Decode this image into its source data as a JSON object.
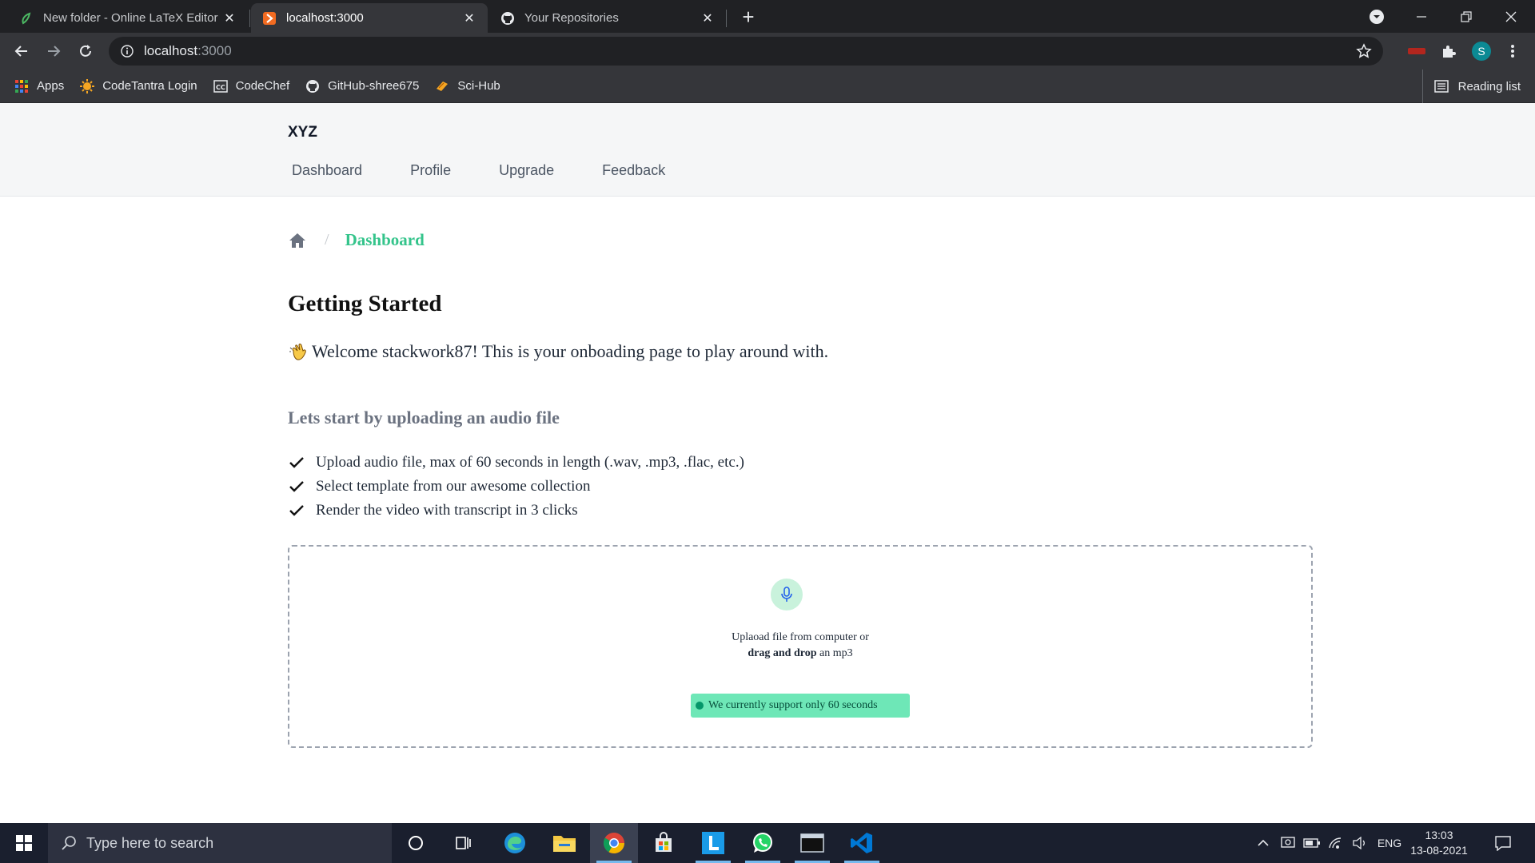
{
  "browser": {
    "tabs": [
      {
        "title": "New folder - Online LaTeX Editor",
        "favicon": "overleaf-leaf-icon",
        "active": false
      },
      {
        "title": "localhost:3000",
        "favicon": "orange-app-icon",
        "active": true
      },
      {
        "title": "Your Repositories",
        "favicon": "github-icon",
        "active": false
      }
    ],
    "url_host": "localhost",
    "url_port": ":3000",
    "profile_initial": "S",
    "bookmarks": [
      {
        "label": "Apps",
        "icon": "apps-grid-icon"
      },
      {
        "label": "CodeTantra Login",
        "icon": "codetantra-icon"
      },
      {
        "label": "CodeChef",
        "icon": "codechef-icon"
      },
      {
        "label": "GitHub-shree675",
        "icon": "github-icon"
      },
      {
        "label": "Sci-Hub",
        "icon": "scihub-icon"
      }
    ],
    "reading_list_label": "Reading list"
  },
  "app": {
    "brand": "XYZ",
    "nav": [
      "Dashboard",
      "Profile",
      "Upgrade",
      "Feedback"
    ],
    "breadcrumb_current": "Dashboard",
    "heading": "Getting Started",
    "welcome_text": "Welcome stackwork87! This is your onboading page to play around with.",
    "subheading": "Lets start by uploading an audio file",
    "checklist": [
      "Upload audio file, max of 60 seconds in length (.wav, .mp3, .flac, etc.)",
      "Select template from our awesome collection",
      "Render the video with transcript in 3 clicks"
    ],
    "dropzone": {
      "line1": "Uplaoad file from computer or",
      "line2_bold": "drag and drop",
      "line2_rest": " an mp3",
      "badge": "We currently support only 60 seconds"
    },
    "colors": {
      "accent": "#34c48b",
      "badge_bg": "#6ee7b7"
    }
  },
  "taskbar": {
    "search_placeholder": "Type here to search",
    "language": "ENG",
    "time": "13:03",
    "date": "13-08-2021"
  }
}
